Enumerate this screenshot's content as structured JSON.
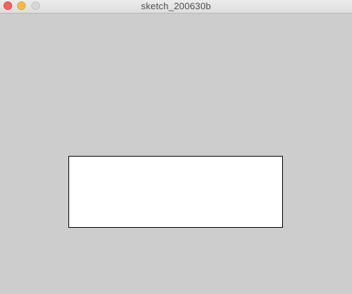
{
  "window": {
    "title": "sketch_200630b"
  },
  "colors": {
    "titlebar_bg": "#e3e3e3",
    "close": "#fc605c",
    "minimize": "#fdbc40",
    "zoom": "#d7d7d7",
    "canvas_bg": "#cdcdcd",
    "rect_fill": "#ffffff",
    "rect_stroke": "#000000"
  },
  "icons": {
    "close": "close-icon",
    "minimize": "minimize-icon",
    "zoom": "zoom-icon"
  }
}
